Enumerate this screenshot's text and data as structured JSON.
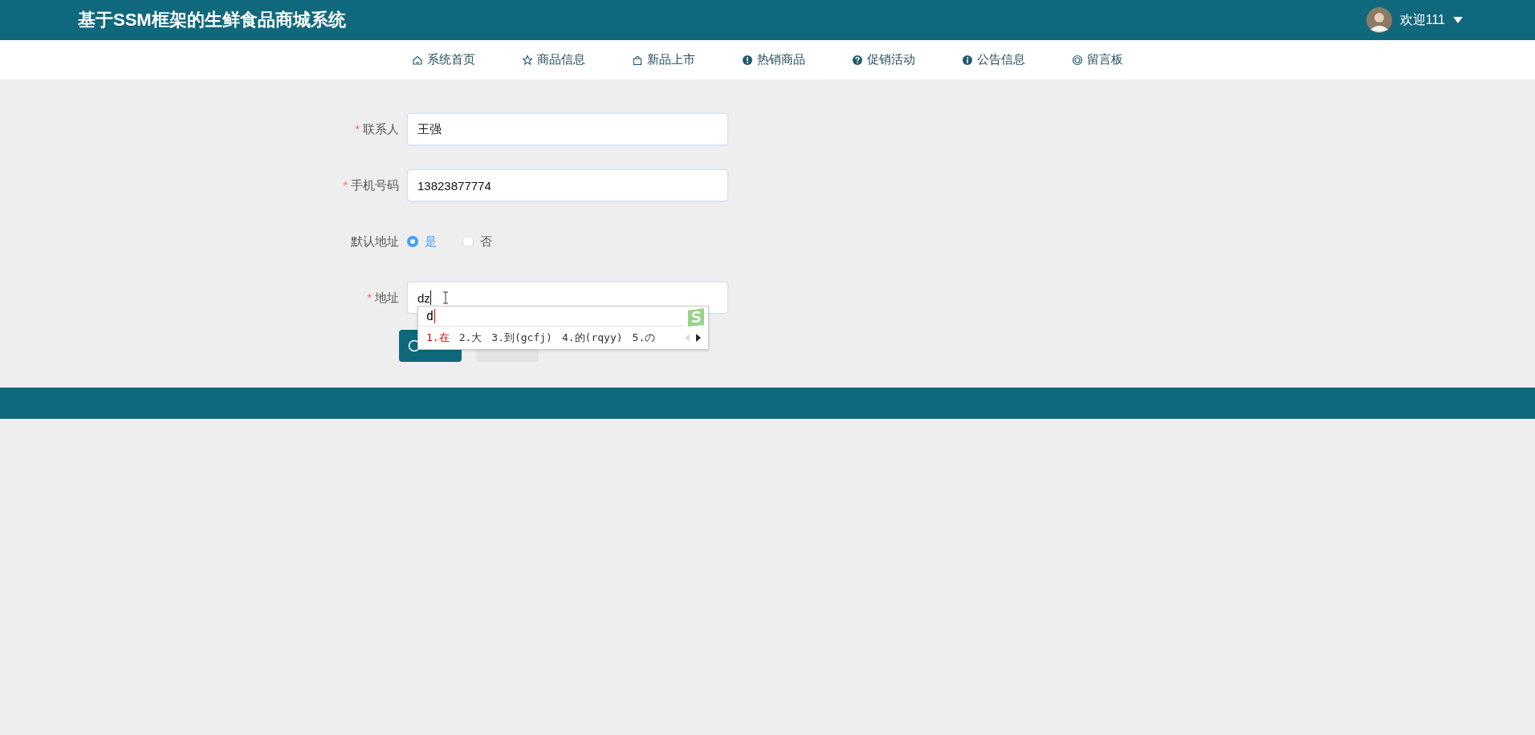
{
  "header": {
    "title": "基于SSM框架的生鲜食品商城系统",
    "user": {
      "greeting": "欢迎111"
    }
  },
  "nav": [
    {
      "label": "系统首页",
      "kind": "home"
    },
    {
      "label": "商品信息",
      "kind": "star"
    },
    {
      "label": "新品上市",
      "kind": "bag"
    },
    {
      "label": "热销商品",
      "kind": "exclaim"
    },
    {
      "label": "促销活动",
      "kind": "question"
    },
    {
      "label": "公告信息",
      "kind": "info"
    },
    {
      "label": "留言板",
      "kind": "ring"
    }
  ],
  "form": {
    "fields": [
      {
        "kind": "text",
        "label": "联系人",
        "marker": "*",
        "value": "王强"
      },
      {
        "kind": "text",
        "label": "手机号码",
        "marker": "*",
        "value": "13823877774"
      },
      {
        "kind": "radio",
        "label": "默认地址",
        "options": [
          {
            "label": "是",
            "selected": true
          },
          {
            "label": "否",
            "selected": false
          }
        ]
      },
      {
        "kind": "text",
        "label": "地址",
        "marker": "*",
        "value": "dz"
      }
    ],
    "buttons": [
      {
        "kind": "primary"
      },
      {
        "kind": "default"
      }
    ]
  },
  "ime": {
    "composition": "d",
    "candidates": [
      {
        "label": "1.在",
        "selected": true
      },
      {
        "label": "2.大",
        "selected": false
      },
      {
        "label": "3.到(gcfj)",
        "selected": false
      },
      {
        "label": "4.的(rqyy)",
        "selected": false
      },
      {
        "label": "5.の",
        "selected": false
      }
    ]
  }
}
